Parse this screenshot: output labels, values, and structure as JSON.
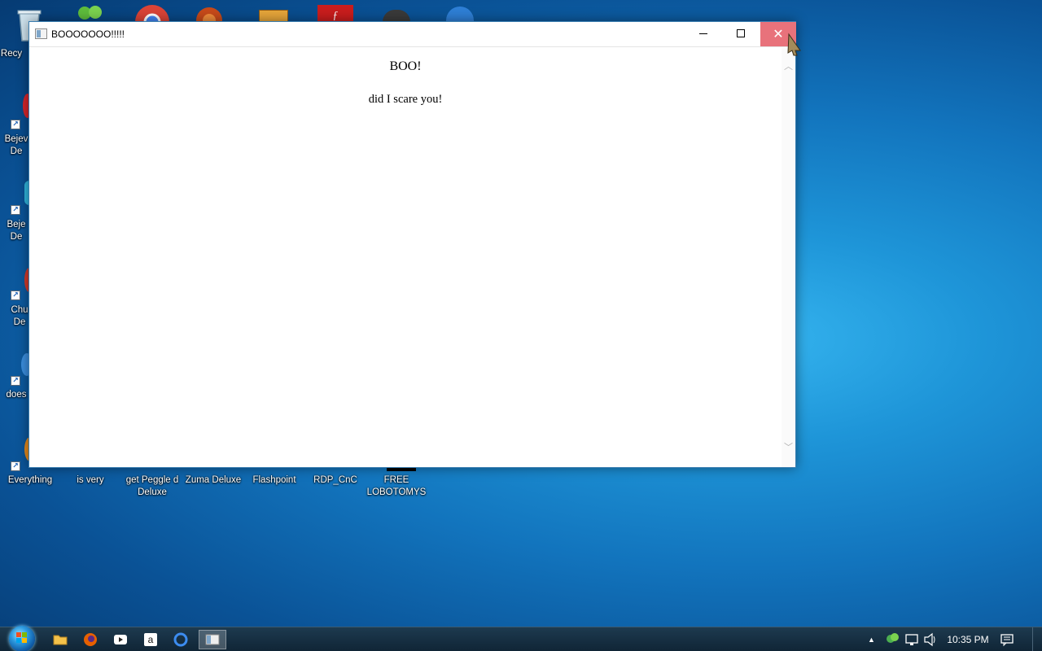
{
  "desktop": {
    "icons": [
      {
        "label": "Recy"
      },
      {
        "label": "Bejev\nDe"
      },
      {
        "label": "Beje\nDe"
      },
      {
        "label": "Chu\nDe"
      },
      {
        "label": "does"
      },
      {
        "label": "Everything"
      },
      {
        "label": "is very"
      },
      {
        "label": "get Peggle d\nDeluxe"
      },
      {
        "label": "Zuma Deluxe"
      },
      {
        "label": "Flashpoint"
      },
      {
        "label": "RDP_CnC"
      },
      {
        "label": "FREE\nLOBOTOMYS"
      }
    ]
  },
  "window": {
    "title": "BOOOOOOO!!!!!",
    "heading": "BOO!",
    "message": "did I scare you!",
    "buttons": {
      "minimize": "minimize-icon",
      "maximize": "maximize-icon",
      "close": "close-icon"
    }
  },
  "taskbar": {
    "pinned": [
      "file-explorer-icon",
      "firefox-icon",
      "youtube-icon",
      "amazon-icon",
      "ie-icon",
      "window-app-icon"
    ],
    "tray": {
      "time": "10:35 PM",
      "icons": [
        "show-hidden-icon",
        "network-tray-icon",
        "display-tray-icon",
        "volume-icon",
        "notification-icon"
      ]
    }
  },
  "colors": {
    "close_hover": "#e8727b",
    "taskbar": "#102536",
    "desktop": "#1274bd"
  }
}
